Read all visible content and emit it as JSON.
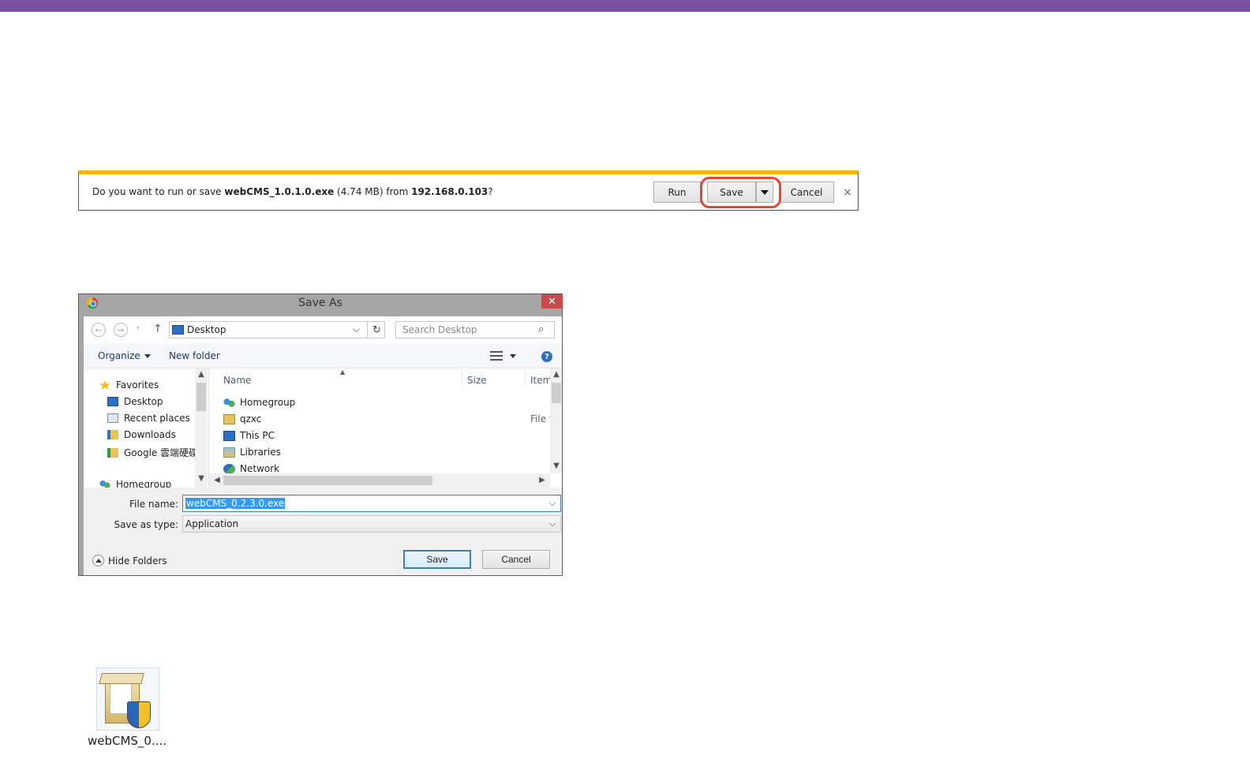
{
  "notification": {
    "prefix": "Do you want to run or save ",
    "filename": "webCMS_1.0.1.0.exe",
    "size": " (4.74 MB) from ",
    "host": "192.168.0.103",
    "suffix": "?",
    "run_label": "Run",
    "save_label": "Save",
    "cancel_label": "Cancel",
    "close_glyph": "×",
    "accent_color": "#f2b705",
    "highlight_color": "#e8472d"
  },
  "dialog": {
    "title": "Save As",
    "close_glyph": "✕",
    "back_glyph": "←",
    "forward_glyph": "→",
    "history_glyph": "▾",
    "up_glyph": "↑",
    "address": "Desktop",
    "address_chevron": "⌵",
    "refresh_glyph": "↻",
    "search_placeholder": "Search Desktop",
    "search_glyph": "⌕",
    "organize_label": "Organize",
    "new_folder_label": "New folder",
    "help_glyph": "?",
    "nav_items": [
      {
        "label": "Favorites",
        "icon": "star-icon"
      },
      {
        "label": "Desktop",
        "icon": "desktop-icon"
      },
      {
        "label": "Recent places",
        "icon": "recent-places-icon"
      },
      {
        "label": "Downloads",
        "icon": "downloads-icon"
      },
      {
        "label": "Google 雲端硬碟",
        "icon": "google-drive-icon"
      },
      {
        "label": "Homegroup",
        "icon": "homegroup-icon"
      }
    ],
    "scroll": {
      "up": "▲",
      "down": "▼",
      "left": "◀",
      "right": "▶",
      "sort": "▲"
    },
    "columns": {
      "name": "Name",
      "size": "Size",
      "type": "Item"
    },
    "files": [
      {
        "name": "Homegroup",
        "type": "",
        "icon": "homegroup-icon"
      },
      {
        "name": "qzxc",
        "type": "File f",
        "icon": "folder-user-icon"
      },
      {
        "name": "This PC",
        "type": "",
        "icon": "computer-icon"
      },
      {
        "name": "Libraries",
        "type": "",
        "icon": "libraries-icon"
      },
      {
        "name": "Network",
        "type": "",
        "icon": "network-icon"
      }
    ],
    "file_name_label": "File name:",
    "file_name_value": "webCMS_0.2.3.0.exe",
    "save_type_label": "Save as type:",
    "save_type_value": "Application",
    "dropdown_glyph": "⌵",
    "hide_folders_label": "Hide Folders",
    "save_label": "Save",
    "cancel_label": "Cancel"
  },
  "desktop": {
    "icon_label": "webCMS_0....",
    "icon": "installer-package-icon"
  },
  "colors": {
    "top_bar": "#7a519e",
    "selection": "#3399ff"
  }
}
